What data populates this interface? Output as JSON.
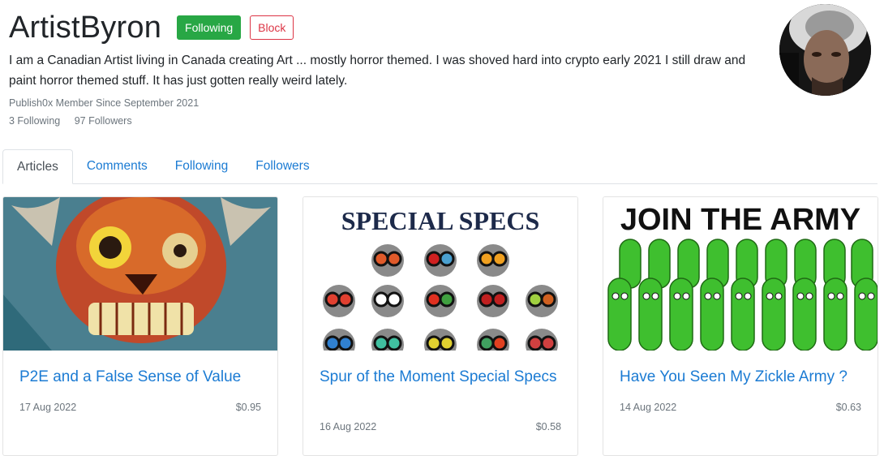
{
  "profile": {
    "username": "ArtistByron",
    "following_button": "Following",
    "block_button": "Block",
    "bio": "I am a Canadian Artist living in Canada creating Art ... mostly horror themed. I was shoved hard into crypto early 2021 I still draw and paint horror themed stuff. It has just gotten really weird lately.",
    "member_since": "Publish0x Member Since September 2021",
    "following_count": "3 Following",
    "followers_count": "97 Followers"
  },
  "tabs": [
    "Articles",
    "Comments",
    "Following",
    "Followers"
  ],
  "active_tab": "Articles",
  "articles": [
    {
      "title": "P2E and a False Sense of Value",
      "date": "17 Aug 2022",
      "price": "$0.95"
    },
    {
      "title": "Spur of the Moment Special Specs",
      "date": "16 Aug 2022",
      "price": "$0.58",
      "image_text": "SPECIAL SPECS"
    },
    {
      "title": "Have You Seen My Zickle Army ?",
      "date": "14 Aug 2022",
      "price": "$0.63",
      "image_text": "JOIN THE ARMY"
    }
  ],
  "colors": {
    "link": "#1b7bd3",
    "following_green": "#28a745",
    "block_red": "#dc3545",
    "muted": "#6c757d"
  }
}
